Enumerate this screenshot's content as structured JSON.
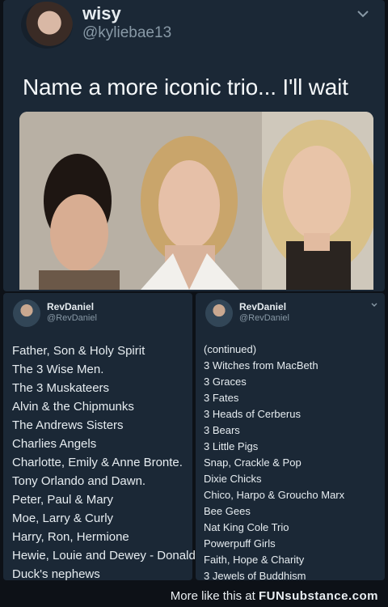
{
  "tweet": {
    "display_name": "wisy",
    "handle": "@kyliebae13",
    "text": "Name a more iconic trio... I'll wait",
    "menu_icon": "chevron-down-icon"
  },
  "reply_left": {
    "display_name": "RevDaniel",
    "handle": "@RevDaniel",
    "items": [
      "Father, Son & Holy Spirit",
      "The 3 Wise Men.",
      "The 3 Muskateers",
      "Alvin & the Chipmunks",
      "The Andrews Sisters",
      "Charlies Angels",
      "Charlotte, Emily & Anne Bronte.",
      "Tony Orlando and Dawn.",
      "Peter, Paul & Mary",
      "Moe, Larry & Curly",
      "Harry, Ron, Hermione",
      "Hewie, Louie and Dewey - Donald",
      "Duck's nephews"
    ]
  },
  "reply_right": {
    "display_name": "RevDaniel",
    "handle": "@RevDaniel",
    "items": [
      "(continued)",
      "3 Witches from MacBeth",
      "3 Graces",
      "3 Fates",
      "3 Heads of Cerberus",
      "3 Bears",
      "3 Little Pigs",
      "Snap, Crackle & Pop",
      "Dixie Chicks",
      "Chico, Harpo & Groucho Marx",
      "Bee Gees",
      "Nat King Cole Trio",
      "Powerpuff Girls",
      "Faith, Hope & Charity",
      "3 Jewels of Buddhism"
    ]
  },
  "footer": {
    "prefix": "More like this at ",
    "brand": "FUNsubstance.com"
  }
}
